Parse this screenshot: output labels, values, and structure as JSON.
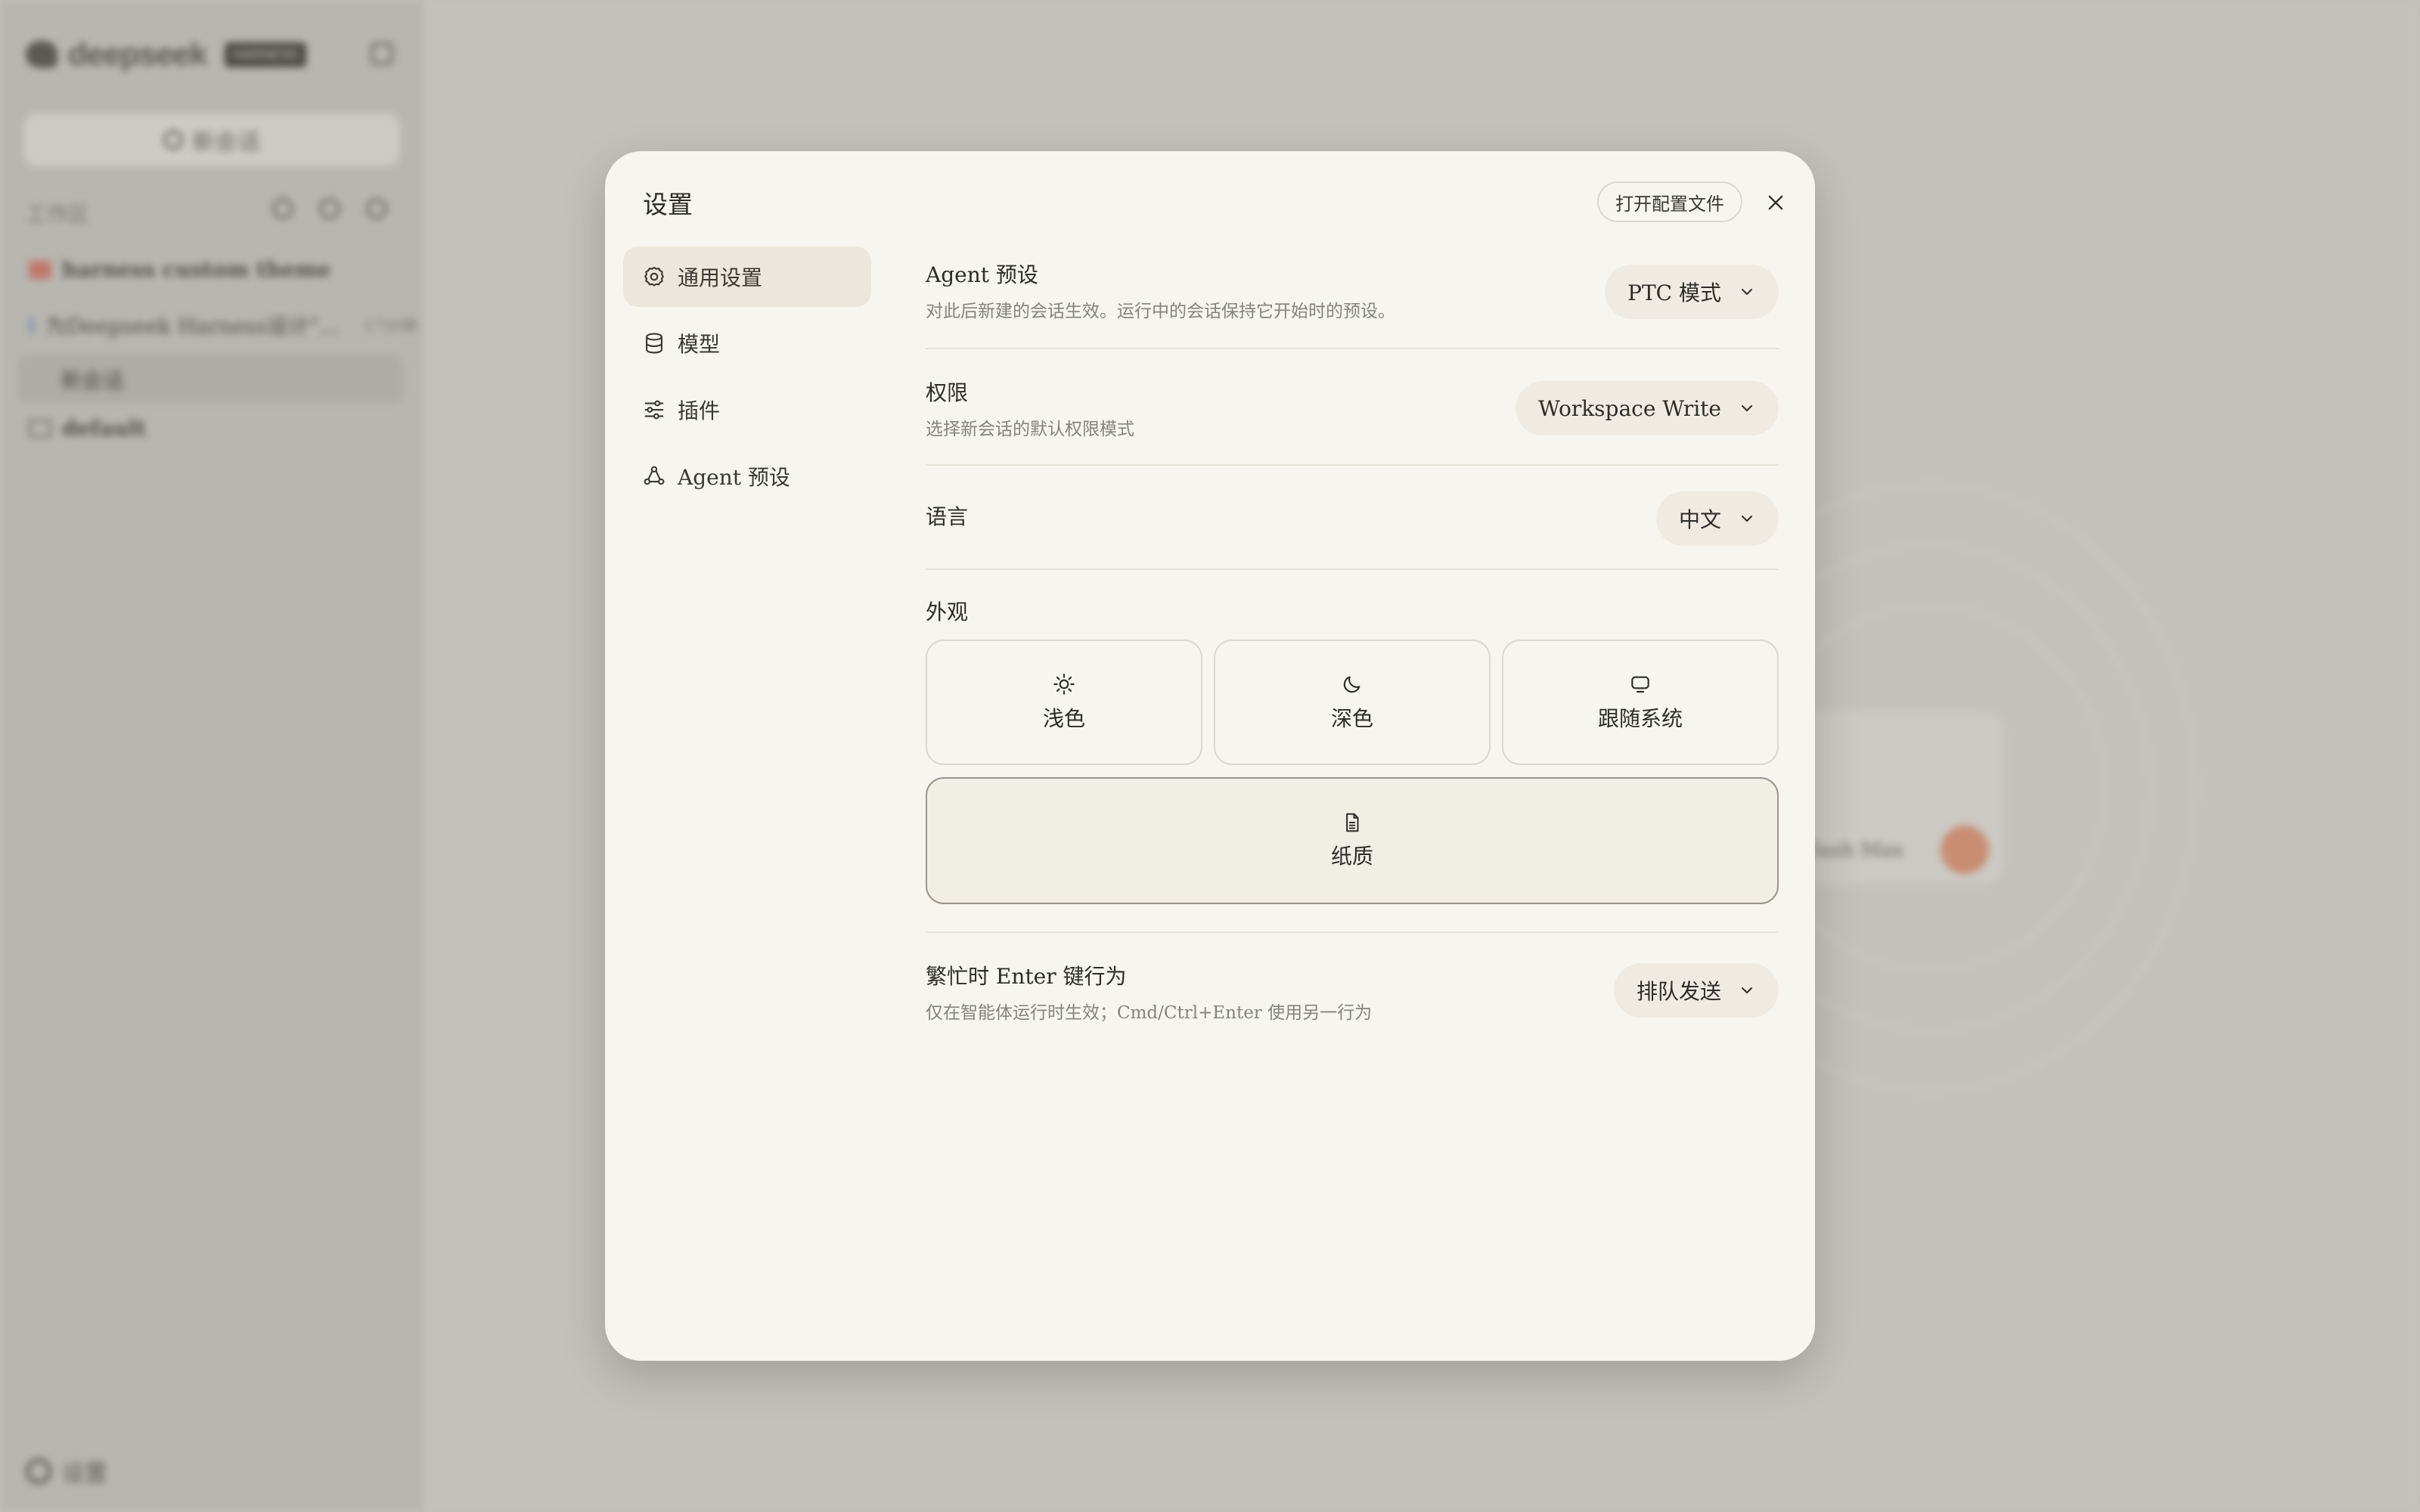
{
  "background": {
    "app_name": "deepseek",
    "badge": "HARNESS",
    "new_chat": "新会话",
    "section_label": "工作区",
    "items": [
      {
        "label": "harness custom theme"
      },
      {
        "label": "为Deepseek Harness设计\"...",
        "time": "17分钟"
      },
      {
        "label": "新会话"
      },
      {
        "label": "default"
      }
    ],
    "settings_label": "设置",
    "model_label": "Flash Max"
  },
  "modal": {
    "title": "设置",
    "open_config": "打开配置文件",
    "nav": [
      {
        "label": "通用设置",
        "icon": "gear-icon",
        "active": true
      },
      {
        "label": "模型",
        "icon": "database-icon"
      },
      {
        "label": "插件",
        "icon": "sliders-icon"
      },
      {
        "label": "Agent 预设",
        "icon": "agent-icon"
      }
    ],
    "agent_preset": {
      "title": "Agent 预设",
      "desc": "对此后新建的会话生效。运行中的会话保持它开始时的预设。",
      "value": "PTC 模式"
    },
    "permission": {
      "title": "权限",
      "desc": "选择新会话的默认权限模式",
      "value": "Workspace Write"
    },
    "language": {
      "title": "语言",
      "value": "中文"
    },
    "appearance": {
      "title": "外观",
      "options": [
        "浅色",
        "深色",
        "跟随系统",
        "纸质"
      ],
      "selected": "纸质"
    },
    "enter_behavior": {
      "title": "繁忙时 Enter 键行为",
      "desc": "仅在智能体运行时生效；Cmd/Ctrl+Enter 使用另一行为",
      "value": "排队发送"
    }
  }
}
